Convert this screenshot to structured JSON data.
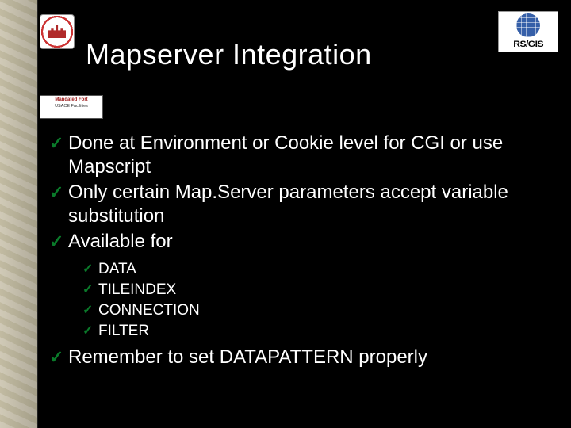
{
  "title": "Mapserver Integration",
  "logos": {
    "right_text": "RS/GIS",
    "left_alt": "usace-seal",
    "badge_line1": "Mandated Fort",
    "badge_line2": "USACE Facilities"
  },
  "bullets": {
    "b1": "Done at Environment or Cookie level for CGI or use Mapscript",
    "b2": "Only certain Map.Server parameters accept variable substitution",
    "b3": "Available for",
    "sub": {
      "s1": "DATA",
      "s2": "TILEINDEX",
      "s3": "CONNECTION",
      "s4": "FILTER"
    },
    "b4": "Remember to set DATAPATTERN properly"
  }
}
